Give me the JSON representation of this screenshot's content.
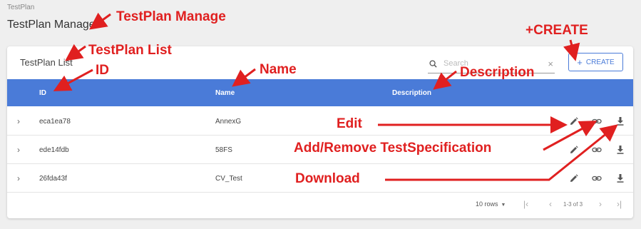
{
  "breadcrumb": "TestPlan",
  "page_title": "TestPlan Manage",
  "card": {
    "title": "TestPlan List",
    "search_placeholder": "Search",
    "clear_glyph": "×",
    "create_label": "CREATE",
    "create_icon": "plus-icon"
  },
  "table": {
    "headers": {
      "id": "ID",
      "name": "Name",
      "description": "Description"
    },
    "rows": [
      {
        "id": "eca1ea78",
        "name": "AnnexG",
        "description": ""
      },
      {
        "id": "ede14fdb",
        "name": "58FS",
        "description": ""
      },
      {
        "id": "26fda43f",
        "name": "CV_Test",
        "description": ""
      }
    ],
    "row_actions": [
      "edit-icon",
      "link-icon",
      "download-icon"
    ]
  },
  "pagination": {
    "rows_per_page": "10 rows",
    "range": "1-3 of 3"
  },
  "annotations": {
    "manage": "TestPlan Manage",
    "list": "TestPlan List",
    "id": "ID",
    "name": "Name",
    "description": "Description",
    "create": "+CREATE",
    "edit": "Edit",
    "add_remove": "Add/Remove TestSpecification",
    "download": "Download"
  },
  "colors": {
    "accent": "#4a7bd8",
    "annotation": "#e02020",
    "background": "#efefef"
  }
}
